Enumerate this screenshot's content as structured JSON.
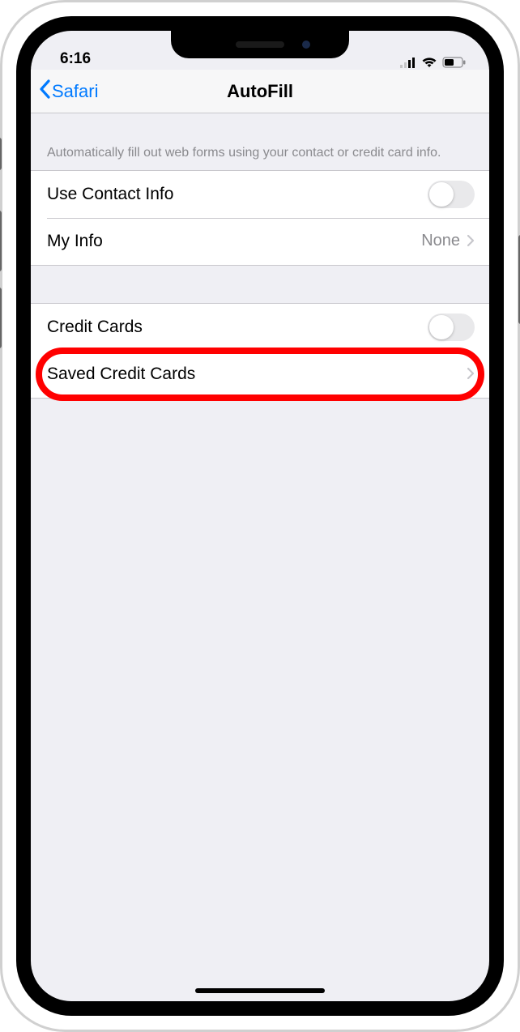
{
  "status": {
    "time": "6:16"
  },
  "nav": {
    "back_label": "Safari",
    "title": "AutoFill"
  },
  "section1": {
    "header": "Automatically fill out web forms using your contact or credit card info.",
    "rows": {
      "contact_info": {
        "label": "Use Contact Info",
        "toggle_on": false
      },
      "my_info": {
        "label": "My Info",
        "detail": "None"
      }
    }
  },
  "section2": {
    "rows": {
      "credit_cards": {
        "label": "Credit Cards",
        "toggle_on": false
      },
      "saved_credit_cards": {
        "label": "Saved Credit Cards"
      }
    }
  },
  "annotation": {
    "highlight_target": "saved-credit-cards-row",
    "highlight_color": "#ff0000"
  }
}
